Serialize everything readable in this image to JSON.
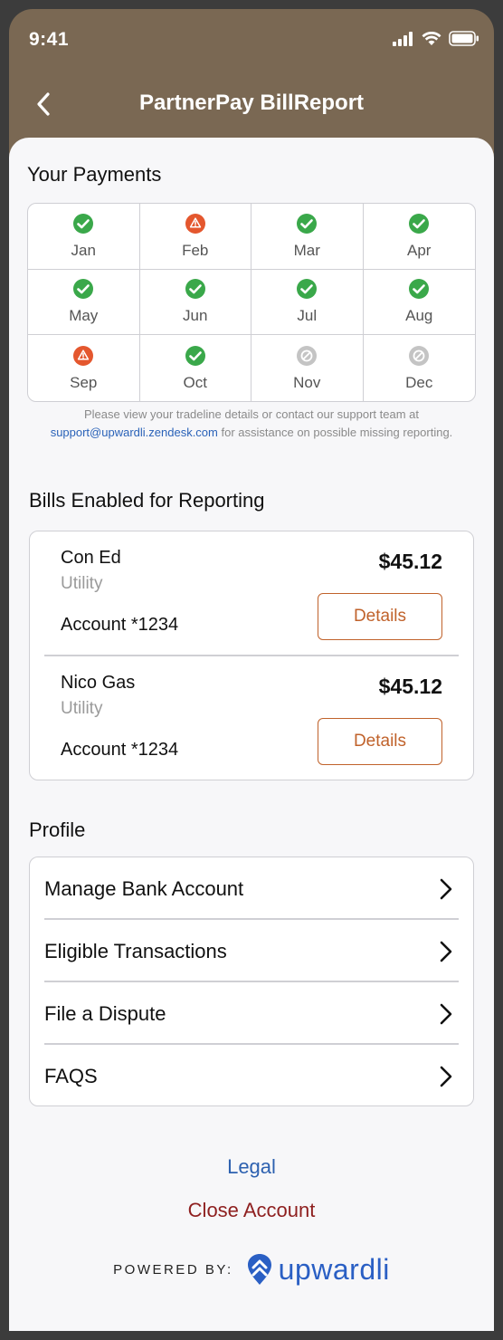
{
  "status_bar": {
    "time": "9:41"
  },
  "header": {
    "title": "PartnerPay BillReport"
  },
  "payments": {
    "title": "Your Payments",
    "months": [
      {
        "label": "Jan",
        "status": "paid"
      },
      {
        "label": "Feb",
        "status": "warning"
      },
      {
        "label": "Mar",
        "status": "paid"
      },
      {
        "label": "Apr",
        "status": "paid"
      },
      {
        "label": "May",
        "status": "paid"
      },
      {
        "label": "Jun",
        "status": "paid"
      },
      {
        "label": "Jul",
        "status": "paid"
      },
      {
        "label": "Aug",
        "status": "paid"
      },
      {
        "label": "Sep",
        "status": "warning"
      },
      {
        "label": "Oct",
        "status": "paid"
      },
      {
        "label": "Nov",
        "status": "none"
      },
      {
        "label": "Dec",
        "status": "none"
      }
    ],
    "note_prefix": "Please view your tradeline details or contact our support team at",
    "support_email": "support@upwardli.zendesk.com",
    "note_suffix": "for assistance on possible missing reporting."
  },
  "bills": {
    "title": "Bills Enabled for Reporting",
    "items": [
      {
        "name": "Con Ed",
        "type": "Utility",
        "account": "Account *1234",
        "amount": "$45.12",
        "button": "Details"
      },
      {
        "name": "Nico Gas",
        "type": "Utility",
        "account": "Account *1234",
        "amount": "$45.12",
        "button": "Details"
      }
    ]
  },
  "profile": {
    "title": "Profile",
    "items": [
      {
        "label": "Manage Bank Account"
      },
      {
        "label": "Eligible Transactions"
      },
      {
        "label": "File a Dispute"
      },
      {
        "label": "FAQS"
      }
    ]
  },
  "footer": {
    "legal": "Legal",
    "close_account": "Close Account",
    "powered_by": "POWERED BY:",
    "brand": "upwardli"
  },
  "colors": {
    "header_bg": "#7a6853",
    "paid": "#3aa84a",
    "warning": "#e4572e",
    "none": "#c4c4c4",
    "accent": "#c0622b",
    "link": "#2d61b0",
    "danger": "#8e1f1f",
    "brand": "#2a5fc4"
  },
  "icons": {
    "paid": "check-circle-icon",
    "warning": "warning-triangle-icon",
    "none": "not-reported-icon"
  }
}
